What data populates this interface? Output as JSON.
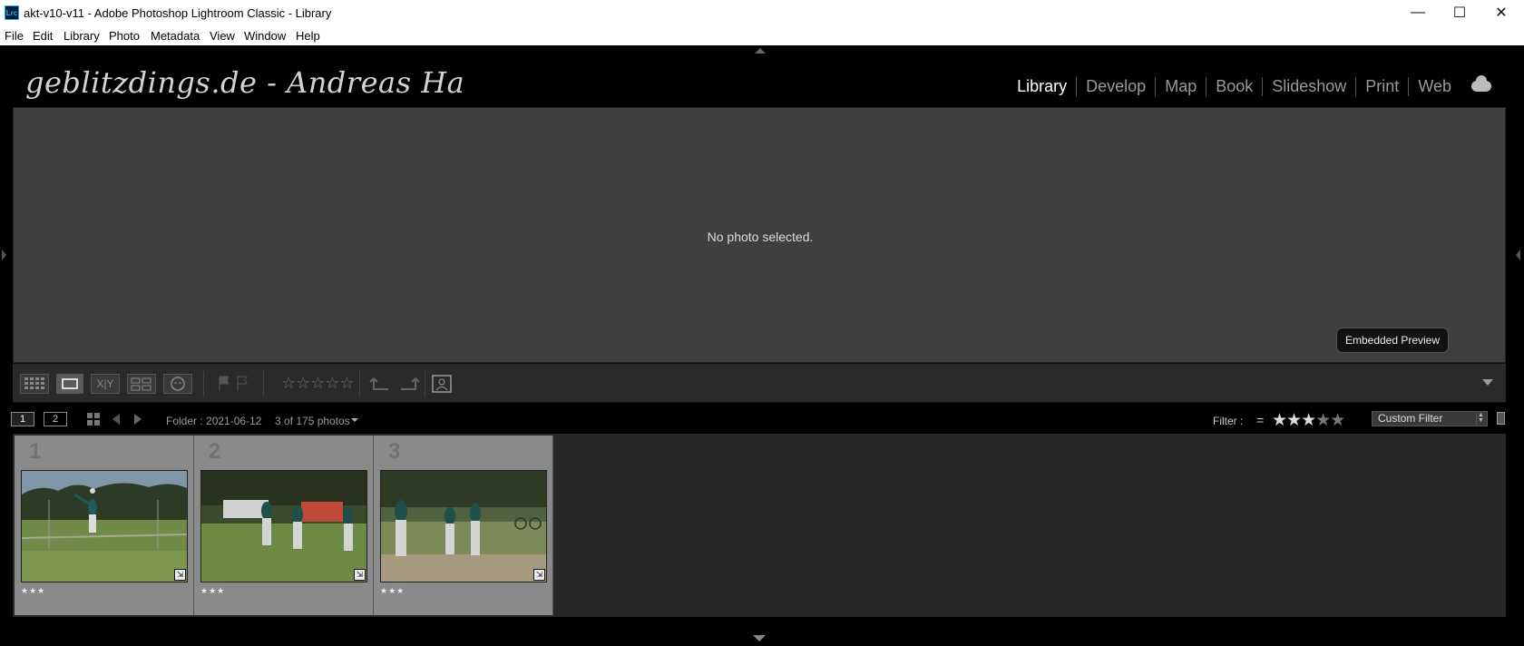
{
  "window": {
    "app_icon": "Lrc",
    "title": "akt-v10-v11 - Adobe Photoshop Lightroom Classic - Library",
    "minimize": "—",
    "maximize": "☐",
    "close": "✕"
  },
  "menu": [
    "File",
    "Edit",
    "Library",
    "Photo",
    "Metadata",
    "View",
    "Window",
    "Help"
  ],
  "identity_plate": "geblitzdings.de - Andreas Ha",
  "modules": [
    "Library",
    "Develop",
    "Map",
    "Book",
    "Slideshow",
    "Print",
    "Web"
  ],
  "active_module": "Library",
  "main": {
    "message": "No photo selected.",
    "preview_badge": "Embedded Preview"
  },
  "toolbar": {
    "compare_label": "X|Y",
    "rating_stars": "☆☆☆☆☆"
  },
  "filmstrip_bar": {
    "screen1": "1",
    "screen2": "2",
    "source": "Folder : 2021-06-12",
    "count": "3 of 175 photos",
    "filter_label": "Filter :",
    "filter_op": "=",
    "filter_rating": 3,
    "filter_preset": "Custom Filter"
  },
  "filmstrip": [
    {
      "index": "1",
      "rating": "★★★"
    },
    {
      "index": "2",
      "rating": "★★★"
    },
    {
      "index": "3",
      "rating": "★★★"
    }
  ],
  "colors": {
    "panel_bg": "#3f3f3f",
    "cell_bg": "#8a8a8a",
    "accent": "#31a8ff"
  }
}
